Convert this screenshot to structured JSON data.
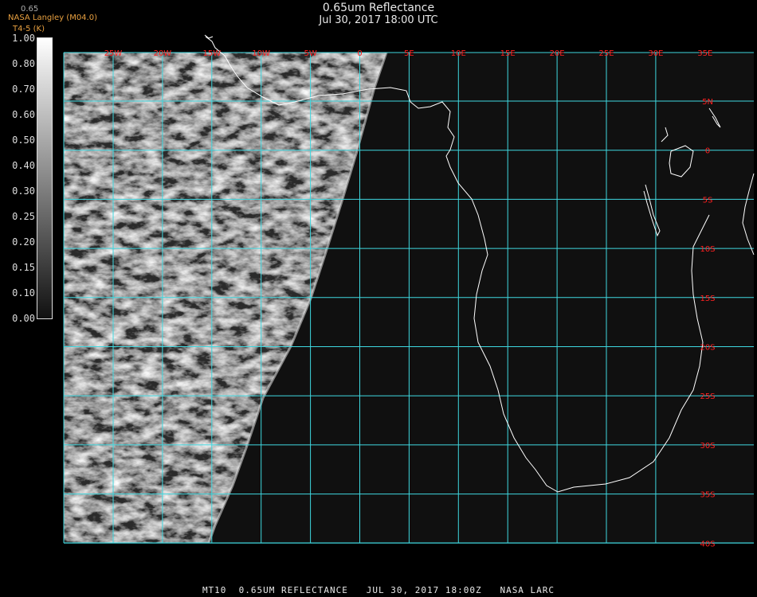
{
  "header": {
    "title": "0.65um Reflectance",
    "datetime": "Jul 30, 2017 18:00 UTC",
    "top_label": "0.65",
    "credit": "NASA Langley (M04.0)",
    "credit_sub": "T4-5 (K)"
  },
  "colorbar": {
    "ticks": [
      "1.00",
      "0.80",
      "0.70",
      "0.60",
      "0.50",
      "0.40",
      "0.30",
      "0.25",
      "0.20",
      "0.15",
      "0.10",
      "0.00"
    ]
  },
  "map": {
    "lon_labels": [
      "25W",
      "20W",
      "15W",
      "10W",
      "5W",
      "0",
      "5E",
      "10E",
      "15E",
      "20E",
      "25E",
      "30E",
      "35E"
    ],
    "lat_labels": [
      "5N",
      "0",
      "5S",
      "10S",
      "15S",
      "20S",
      "25S",
      "30S",
      "35S",
      "40S"
    ],
    "colors": {
      "grid": "#3fd8e0",
      "coast": "#ffffff",
      "label": "#ff2020"
    }
  },
  "footer": {
    "text": "MT10  0.65UM REFLECTANCE   JUL 30, 2017 18:00Z   NASA LARC"
  }
}
